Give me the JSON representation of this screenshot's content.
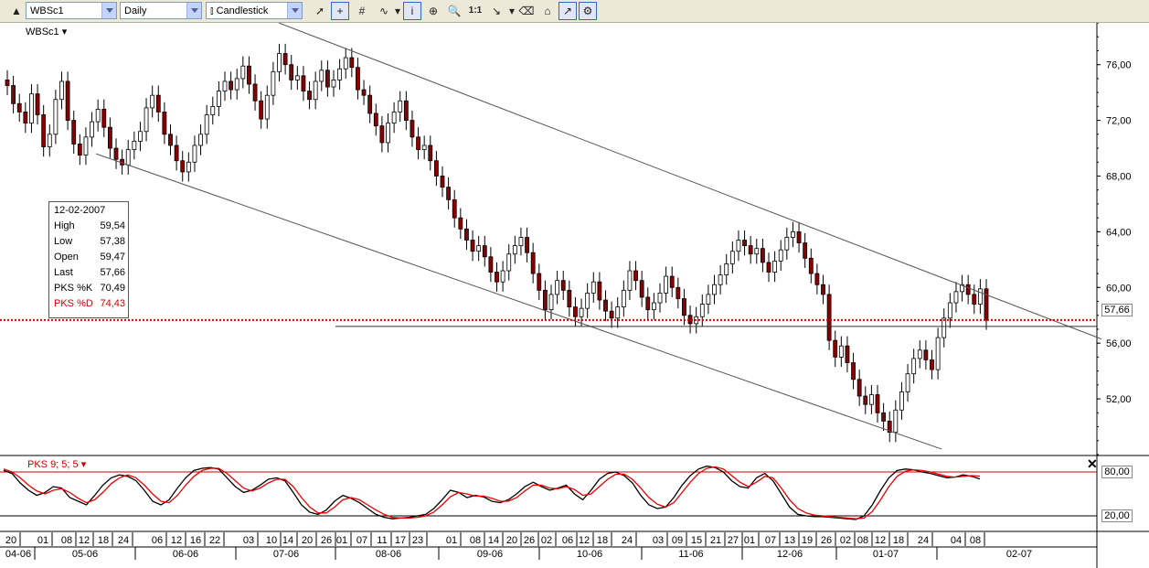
{
  "toolbar": {
    "symbol": "WBSc1",
    "interval": "Daily",
    "chart_type": "Candlestick",
    "buttons": [
      {
        "name": "pointer-tool-button",
        "glyph": "➚"
      },
      {
        "name": "crosshair-button",
        "glyph": "+"
      },
      {
        "name": "grid-toggle-button",
        "glyph": "#"
      },
      {
        "name": "indicator-button",
        "glyph": "∿"
      },
      {
        "name": "indicator-menu-button",
        "glyph": "▾"
      },
      {
        "name": "info-button",
        "glyph": "i"
      },
      {
        "name": "zoom-area-button",
        "glyph": "⊕"
      },
      {
        "name": "zoom-button",
        "glyph": "🔍"
      },
      {
        "name": "zoom-reset-button",
        "glyph": "1:1"
      },
      {
        "name": "trendline-button",
        "glyph": "↘"
      },
      {
        "name": "trendline-menu-button",
        "glyph": "▾"
      },
      {
        "name": "eraser-button",
        "glyph": "⌫"
      },
      {
        "name": "lock-button",
        "glyph": "⌂"
      },
      {
        "name": "arrow-tool-button",
        "glyph": "↗"
      },
      {
        "name": "settings-button",
        "glyph": "⚙"
      }
    ]
  },
  "chart": {
    "symbol_label": "WBSc1",
    "last_price_label": "57,66",
    "info": {
      "date": "12-02-2007",
      "rows": [
        {
          "k": "High",
          "v": "59,54",
          "color": "#000000"
        },
        {
          "k": "Low",
          "v": "57,38",
          "color": "#000000"
        },
        {
          "k": "Open",
          "v": "59,47",
          "color": "#000000"
        },
        {
          "k": "Last",
          "v": "57,66",
          "color": "#000000"
        },
        {
          "k": "PKS %K",
          "v": "70,49",
          "color": "#000000"
        },
        {
          "k": "PKS %D",
          "v": "74,43",
          "color": "#cc0000"
        }
      ]
    },
    "oscillator_label": "PKS 9; 5; 5",
    "close_glyph": "✕",
    "overbought_label": "80,00",
    "oversold_label": "20,00"
  },
  "chart_data": {
    "type": "candlestick",
    "symbol": "WBSc1",
    "interval": "Daily",
    "y_ticks": [
      "52,00",
      "56,00",
      "60,00",
      "64,00",
      "68,00",
      "72,00",
      "76,00"
    ],
    "ylim": [
      48,
      79
    ],
    "osc_ticks": [
      "20,00",
      "80,00"
    ],
    "day_labels": [
      "20",
      "01",
      "08",
      "12",
      "18",
      "24",
      "06",
      "12",
      "16",
      "22",
      "03",
      "10",
      "14",
      "20",
      "26",
      "01",
      "07",
      "11",
      "17",
      "23",
      "01",
      "08",
      "14",
      "20",
      "26",
      "02",
      "06",
      "12",
      "18",
      "24",
      "03",
      "09",
      "15",
      "21",
      "27",
      "01",
      "07",
      "13",
      "19",
      "26",
      "02",
      "08",
      "12",
      "18",
      "24",
      "04",
      "08"
    ],
    "month_labels": [
      "04-06",
      "05-06",
      "06-06",
      "07-06",
      "08-06",
      "09-06",
      "10-06",
      "11-06",
      "12-06",
      "01-07",
      "02-07"
    ],
    "closes": [
      74.5,
      73.2,
      72.6,
      71.8,
      73.9,
      72.4,
      70.1,
      71.0,
      73.5,
      74.8,
      72.0,
      70.3,
      69.5,
      70.8,
      71.9,
      72.8,
      71.5,
      70.0,
      69.2,
      68.8,
      69.9,
      70.5,
      71.2,
      72.9,
      73.8,
      72.6,
      71.0,
      70.2,
      69.1,
      68.3,
      69.0,
      70.2,
      71.0,
      72.4,
      73.0,
      74.1,
      74.8,
      74.2,
      75.0,
      75.9,
      74.6,
      73.4,
      72.1,
      73.8,
      75.5,
      76.8,
      76.0,
      74.9,
      75.2,
      74.1,
      73.5,
      74.8,
      75.6,
      74.4,
      74.9,
      75.7,
      76.5,
      75.8,
      74.2,
      73.8,
      72.5,
      71.6,
      70.4,
      71.8,
      72.6,
      73.4,
      72.0,
      70.8,
      69.9,
      70.2,
      69.1,
      68.0,
      67.2,
      66.3,
      65.0,
      64.2,
      63.4,
      62.6,
      63.0,
      62.2,
      61.1,
      60.4,
      61.2,
      62.4,
      63.0,
      63.6,
      62.5,
      61.0,
      59.8,
      58.4,
      59.5,
      60.5,
      59.8,
      58.6,
      57.9,
      58.5,
      59.6,
      60.4,
      59.1,
      58.3,
      57.8,
      58.6,
      59.8,
      61.2,
      60.5,
      59.3,
      58.4,
      58.9,
      59.6,
      60.8,
      60.0,
      59.2,
      58.0,
      57.4,
      57.9,
      58.8,
      59.5,
      60.2,
      60.9,
      61.7,
      62.6,
      63.4,
      63.0,
      62.4,
      62.8,
      61.8,
      61.1,
      61.9,
      62.7,
      63.6,
      64.0,
      63.2,
      62.1,
      61.0,
      60.2,
      59.5,
      56.2,
      55.0,
      55.8,
      54.6,
      53.4,
      52.2,
      51.6,
      52.3,
      51.0,
      50.4,
      49.6,
      51.2,
      52.5,
      53.8,
      54.9,
      55.5,
      54.8,
      54.1,
      56.4,
      57.8,
      58.9,
      59.7,
      60.2,
      59.5,
      58.8,
      59.9,
      57.66
    ],
    "pks_k": [
      82,
      78,
      65,
      55,
      48,
      52,
      60,
      58,
      45,
      40,
      35,
      48,
      62,
      72,
      76,
      74,
      68,
      55,
      40,
      35,
      42,
      58,
      72,
      82,
      85,
      86,
      84,
      72,
      60,
      52,
      55,
      62,
      70,
      72,
      68,
      52,
      35,
      25,
      22,
      28,
      40,
      48,
      44,
      38,
      30,
      22,
      18,
      16,
      17,
      18,
      20,
      22,
      30,
      42,
      55,
      52,
      45,
      48,
      46,
      40,
      38,
      42,
      50,
      60,
      66,
      60,
      55,
      58,
      62,
      50,
      42,
      55,
      70,
      78,
      80,
      75,
      65,
      48,
      35,
      30,
      32,
      45,
      62,
      75,
      84,
      88,
      86,
      80,
      68,
      60,
      58,
      72,
      78,
      68,
      50,
      32,
      22,
      20,
      19,
      19,
      18,
      17,
      16,
      15,
      20,
      35,
      55,
      72,
      82,
      84,
      83,
      80,
      78,
      75,
      72,
      73,
      76,
      74,
      70.49
    ],
    "pks_d": [
      84,
      80,
      72,
      62,
      54,
      50,
      55,
      57,
      52,
      44,
      38,
      42,
      52,
      64,
      72,
      76,
      72,
      62,
      50,
      40,
      38,
      48,
      62,
      74,
      82,
      85,
      85,
      78,
      68,
      58,
      54,
      58,
      65,
      70,
      70,
      60,
      45,
      32,
      24,
      24,
      32,
      42,
      45,
      42,
      35,
      28,
      22,
      18,
      17,
      17,
      18,
      20,
      25,
      35,
      46,
      52,
      50,
      47,
      47,
      44,
      40,
      40,
      45,
      54,
      62,
      62,
      58,
      57,
      60,
      56,
      48,
      50,
      60,
      70,
      77,
      77,
      70,
      58,
      45,
      36,
      32,
      38,
      52,
      66,
      78,
      85,
      87,
      84,
      75,
      66,
      60,
      66,
      74,
      72,
      58,
      42,
      30,
      24,
      21,
      20,
      19,
      18,
      17,
      16,
      17,
      26,
      42,
      60,
      74,
      81,
      83,
      82,
      80,
      77,
      74,
      73,
      74,
      75,
      74.43
    ],
    "trend_channel": {
      "upper_line": "from ~79 (late-06) to ~56 (02-07)",
      "lower_line": "from ~69.5 (05-06) to ~48.5 (01-07)"
    },
    "support_level": 57.2,
    "last_price": 57.66,
    "oscillator": {
      "name": "PKS 9; 5; 5",
      "levels": [
        20,
        80
      ]
    }
  }
}
